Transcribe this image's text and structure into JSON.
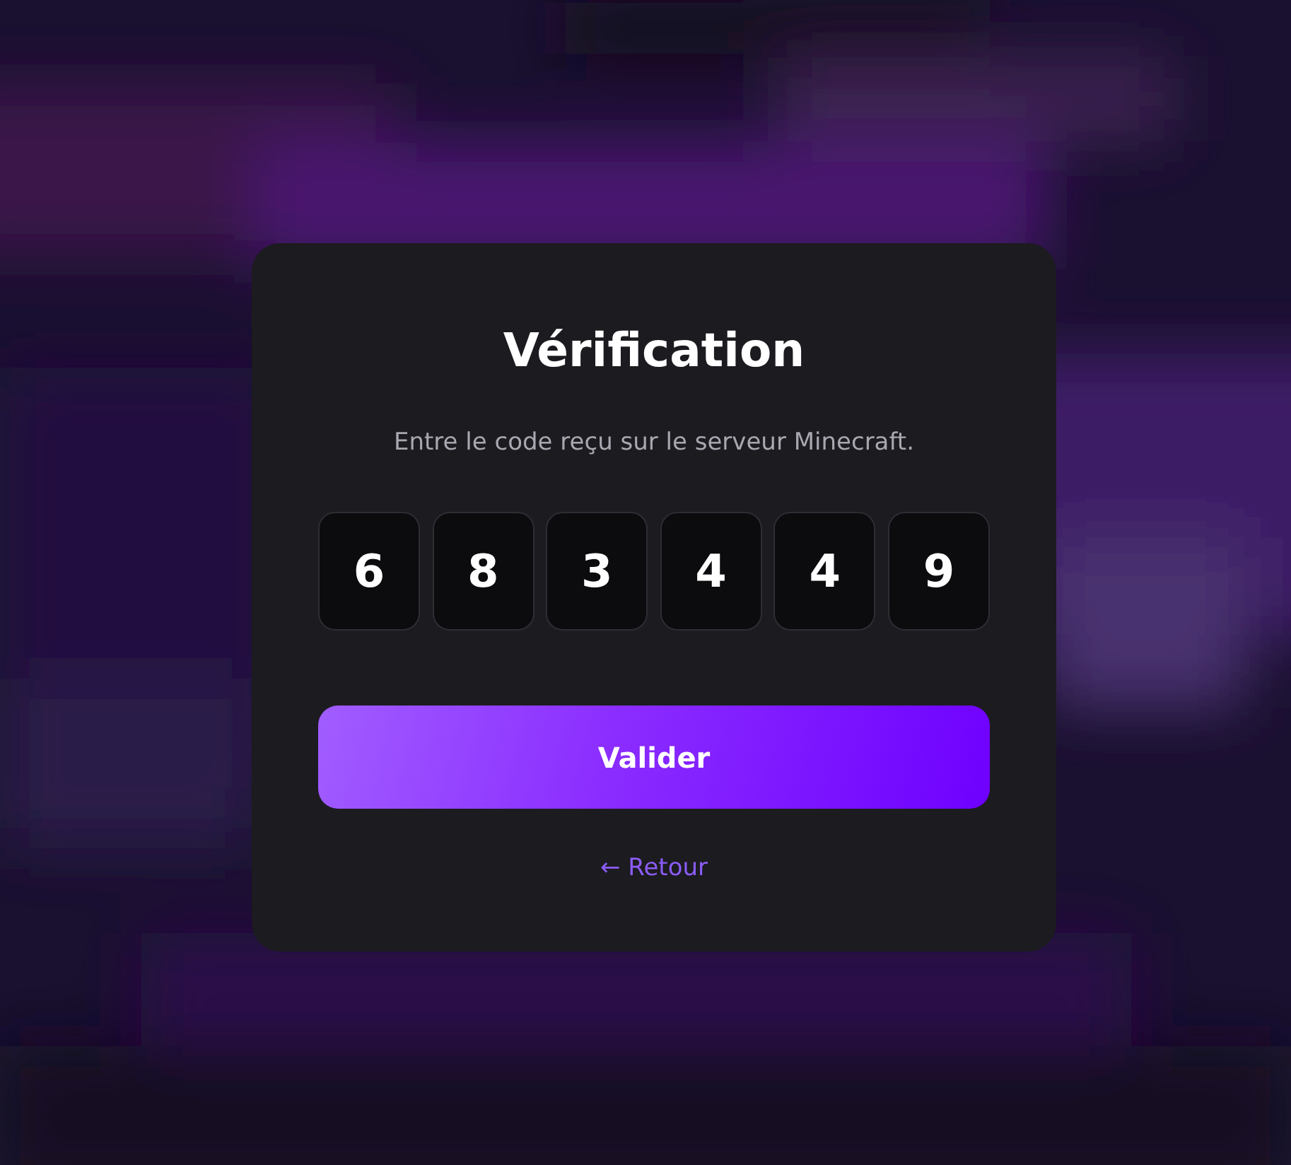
{
  "card": {
    "title": "Vérification",
    "subtitle": "Entre le code reçu sur le serveur Minecraft.",
    "code_digits": [
      {
        "value": "6"
      },
      {
        "value": "8"
      },
      {
        "value": "3"
      },
      {
        "value": "4"
      },
      {
        "value": "4"
      },
      {
        "value": "9"
      }
    ],
    "submit_button": "Valider",
    "back_link": "← Retour"
  }
}
